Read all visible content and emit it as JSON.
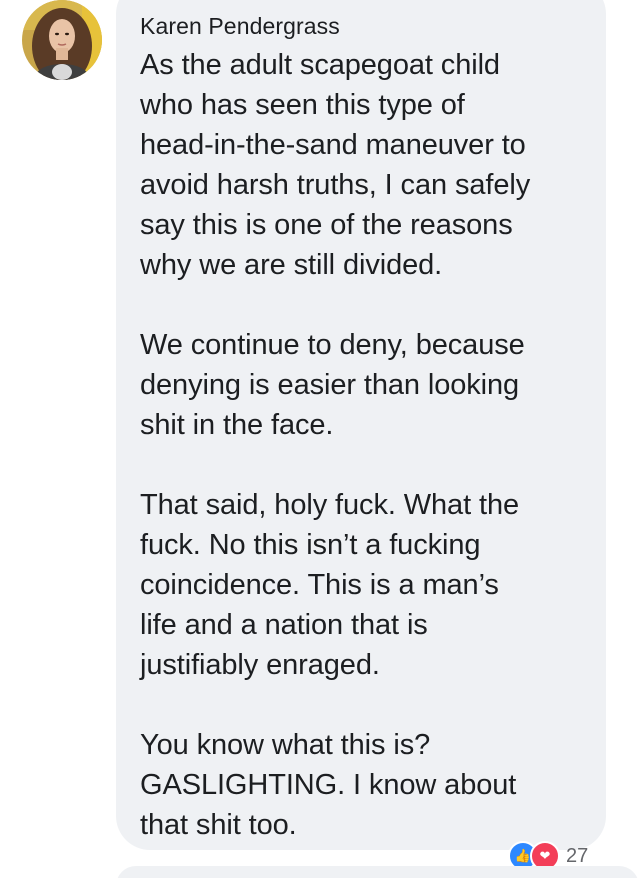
{
  "comment": {
    "author": "Karen Pendergrass",
    "paragraphs": [
      "As the adult scapegoat child\nwho has seen this type of\nhead-in-the-sand maneuver to\navoid harsh truths, I can safely\nsay this is one of the reasons\nwhy we are still divided.",
      "We continue to deny, because\ndenying is easier than looking\nshit in the face.",
      "That said, holy fuck. What the\nfuck.  No this isn’t a fucking\ncoincidence.  This is a man’s\nlife and a nation that is\njustifiably enraged.",
      "You know what this is?\nGASLIGHTING.  I know about\nthat shit too."
    ],
    "reactions": {
      "icons": [
        "like-icon",
        "love-icon"
      ],
      "count": "27"
    }
  },
  "colors": {
    "bubble": "#eff1f4",
    "text": "#1c1e21",
    "like": "#2d88ff",
    "love": "#f33e58"
  }
}
